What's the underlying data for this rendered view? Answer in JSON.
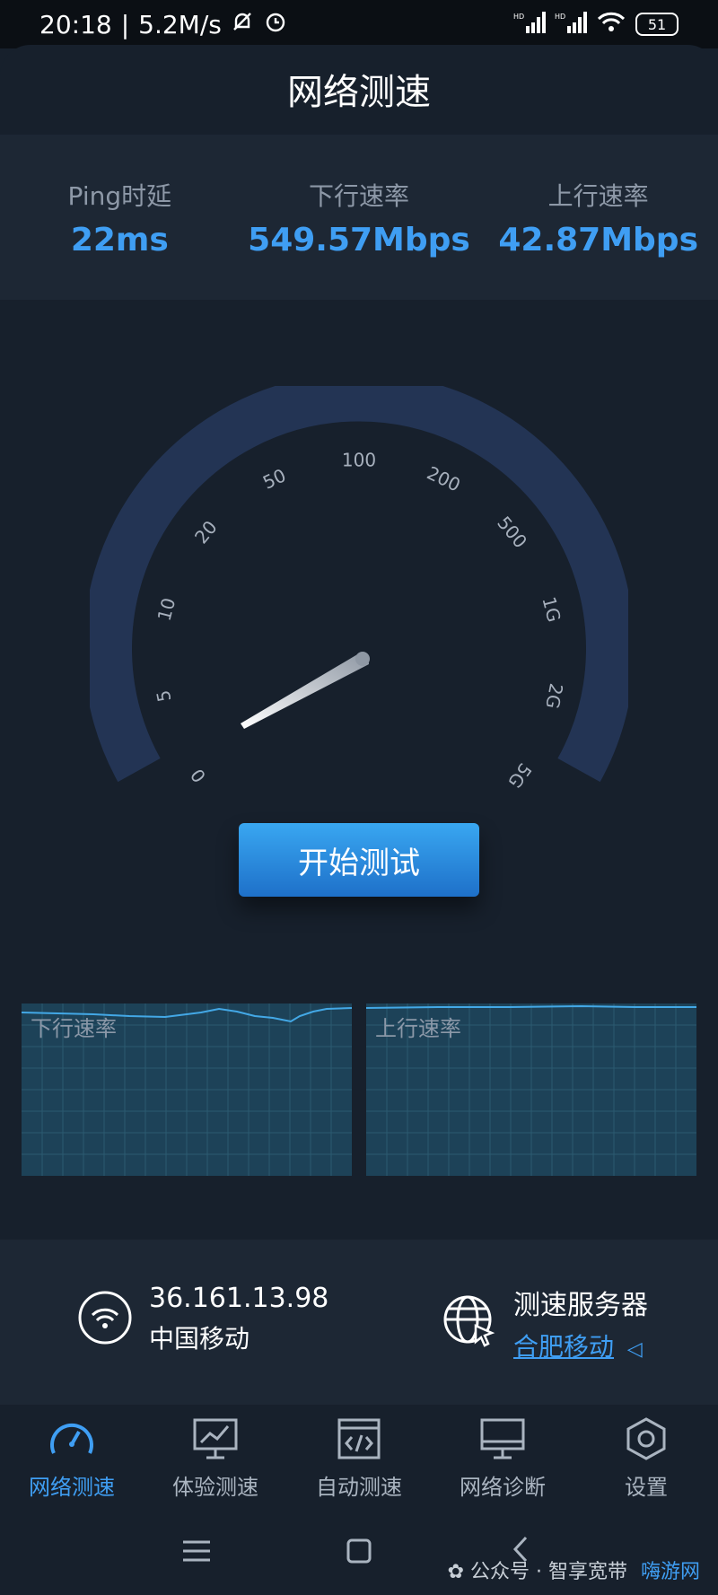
{
  "status": {
    "time": "20:18",
    "speed": "5.2M/s",
    "battery": "51"
  },
  "header": {
    "title": "网络测速"
  },
  "stats": {
    "ping": {
      "label": "Ping时延",
      "value": "22ms"
    },
    "download": {
      "label": "下行速率",
      "value": "549.57Mbps"
    },
    "upload": {
      "label": "上行速率",
      "value": "42.87Mbps"
    }
  },
  "gauge": {
    "scale_labels": [
      "0",
      "5",
      "10",
      "20",
      "50",
      "100",
      "200",
      "500",
      "1G",
      "2G",
      "5G"
    ],
    "needle_value": "5"
  },
  "main": {
    "start_label": "开始测试"
  },
  "charts": {
    "download_label": "下行速率",
    "upload_label": "上行速率"
  },
  "info": {
    "ip": "36.161.13.98",
    "isp": "中国移动",
    "server_label": "测速服务器",
    "server_value": "合肥移动"
  },
  "nav": {
    "items": [
      {
        "label": "网络测速",
        "icon": "speedometer-icon"
      },
      {
        "label": "体验测速",
        "icon": "monitor-chart-icon"
      },
      {
        "label": "自动测速",
        "icon": "browser-code-icon"
      },
      {
        "label": "网络诊断",
        "icon": "monitor-icon"
      },
      {
        "label": "设置",
        "icon": "settings-hexagon-icon"
      }
    ]
  },
  "watermark": {
    "text": "公众号 · 智享宽带",
    "brand": "嗨游网"
  },
  "colors": {
    "accent": "#3f9ef3",
    "bg": "#17202c",
    "panel": "#1d2734",
    "gauge_arc": "#233454"
  }
}
